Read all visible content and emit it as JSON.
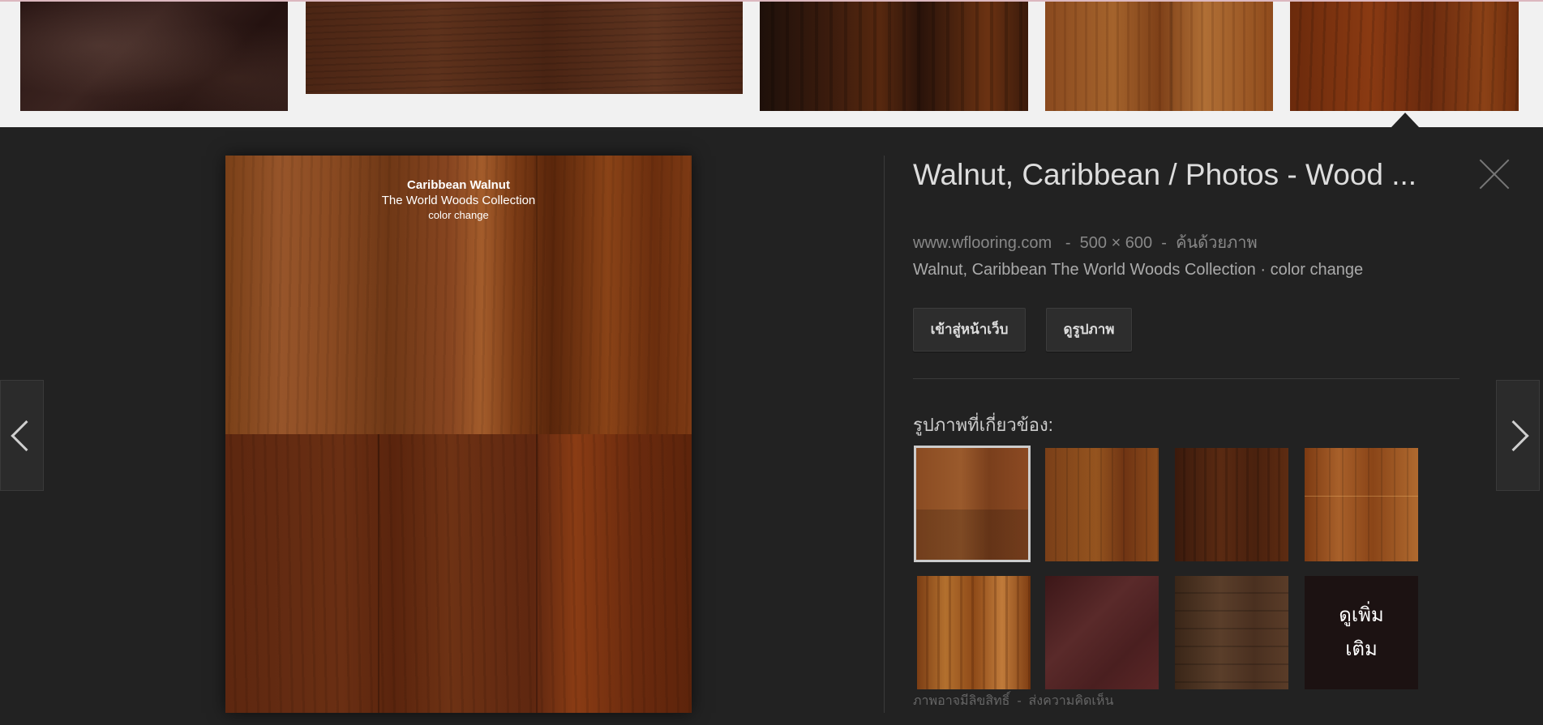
{
  "preview": {
    "image_caption": {
      "title": "Caribbean Walnut",
      "collection": "The World Woods Collection",
      "note": "color change"
    },
    "title": "Walnut, Caribbean / Photos - Wood ...",
    "source": "www.wflooring.com",
    "dimensions": "500 × 600",
    "search_by_image": "ค้นด้วยภาพ",
    "meta_sep": "-",
    "description": "Walnut, Caribbean The World Woods Collection · color change",
    "visit_page_label": "เข้าสู่หน้าเว็บ",
    "view_image_label": "ดูรูปภาพ",
    "related_label": "รูปภาพที่เกี่ยวข้อง:",
    "more_label": "ดูเพิ่มเติม",
    "footer": {
      "copyright": "ภาพอาจมีลิขสิทธิ์",
      "sep": "-",
      "feedback": "ส่งความคิดเห็น"
    }
  },
  "icons": {
    "close": "close-icon",
    "prev": "chevron-left-icon",
    "next": "chevron-right-icon"
  },
  "colors": {
    "panel_bg": "#222222",
    "page_bg": "#f1f1f1",
    "title": "#dddddd",
    "meta": "#888888"
  }
}
